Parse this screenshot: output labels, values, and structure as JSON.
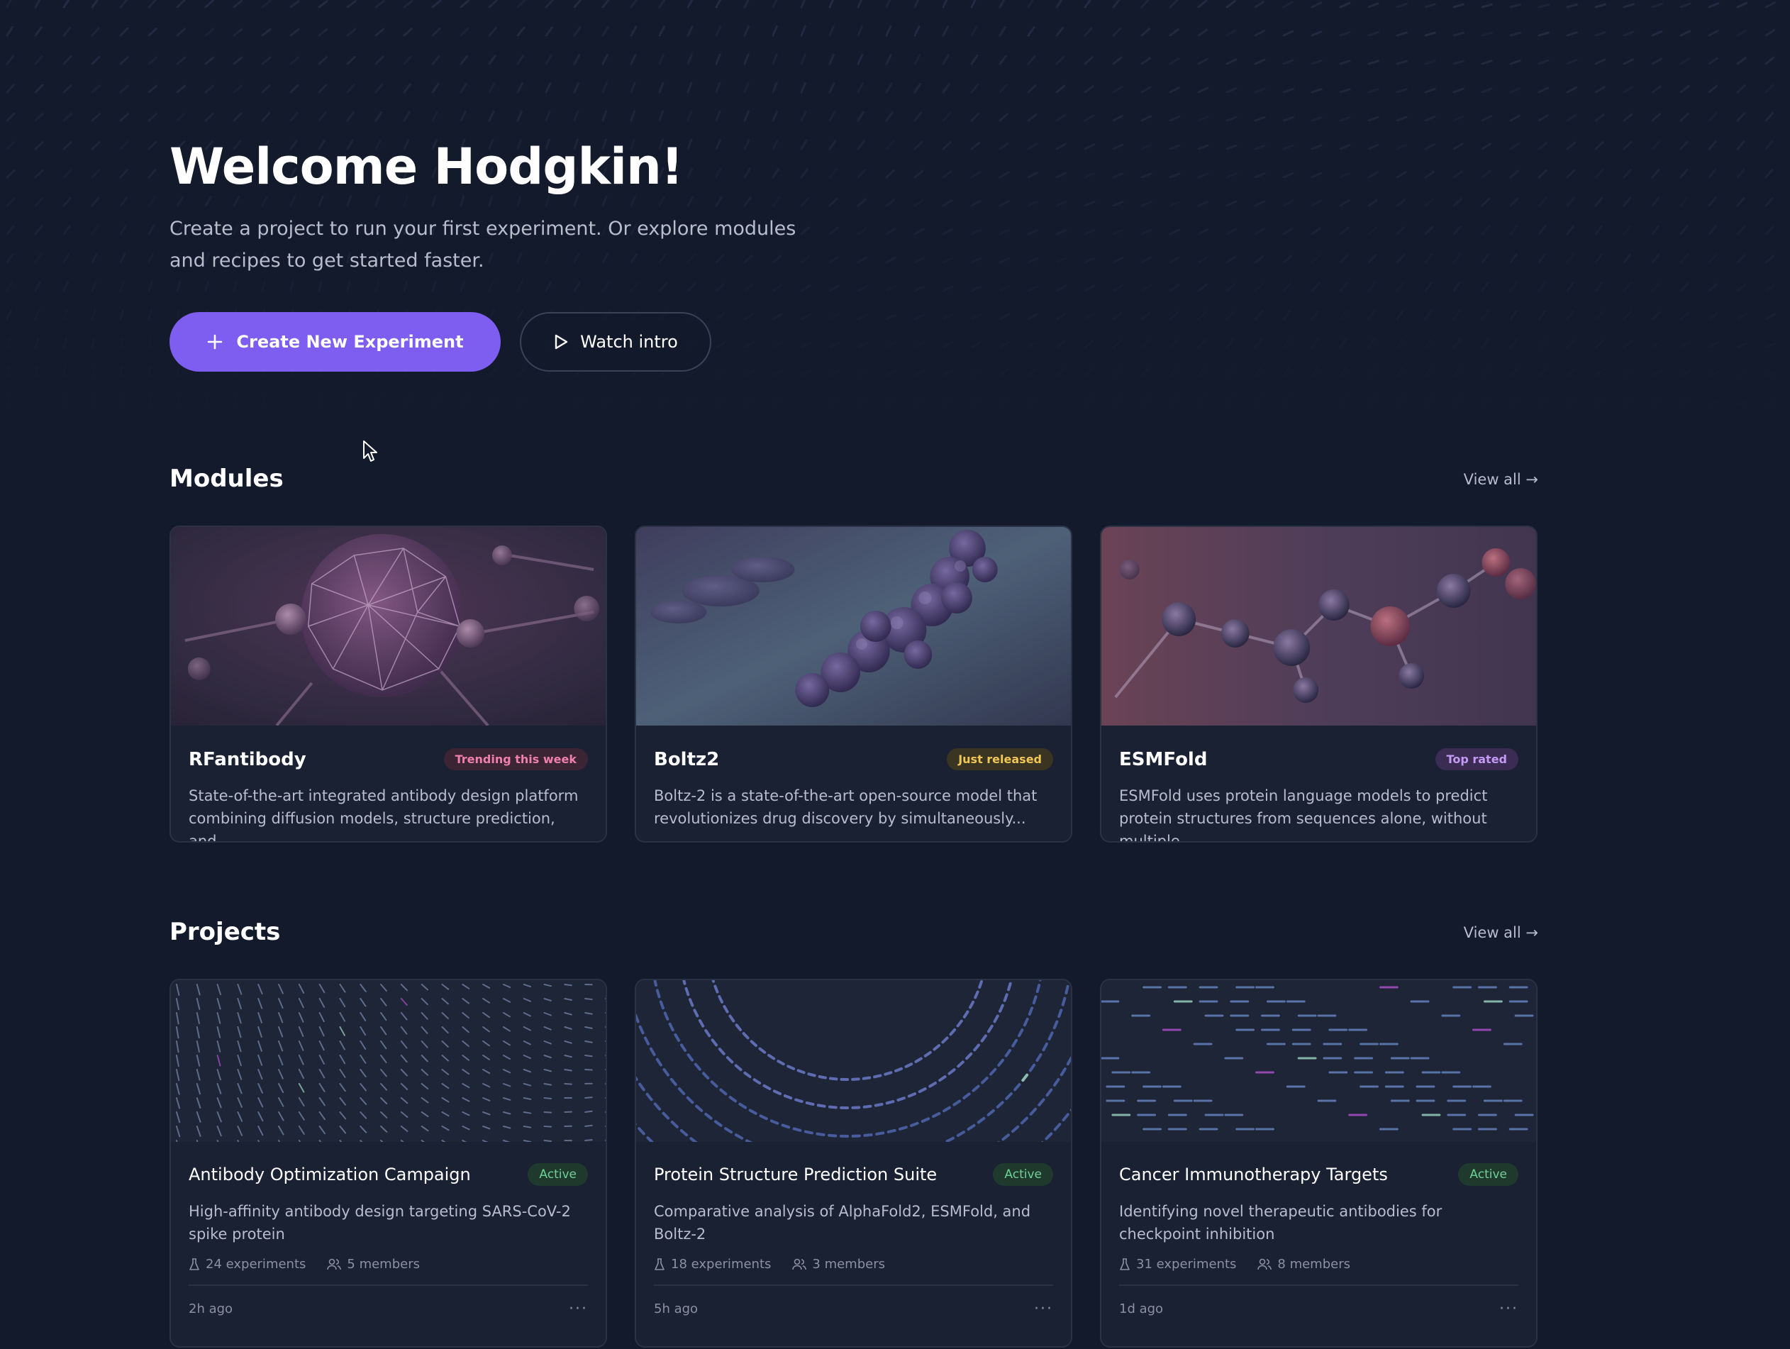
{
  "hero": {
    "title": "Welcome Hodgkin!",
    "subtitle": "Create a project to run your first experiment. Or explore modules and recipes to get started faster.",
    "primary_button": "Create New Experiment",
    "secondary_button": "Watch intro"
  },
  "modules": {
    "title": "Modules",
    "view_all": "View all →",
    "items": [
      {
        "name": "RFantibody",
        "badge": "Trending this week",
        "description": "State-of-the-art integrated antibody design platform combining diffusion models, structure prediction, and..."
      },
      {
        "name": "Boltz2",
        "badge": "Just released",
        "description": "Boltz-2 is a state-of-the-art open-source model that revolutionizes drug discovery by simultaneously..."
      },
      {
        "name": "ESMFold",
        "badge": "Top rated",
        "description": "ESMFold uses protein language models to predict protein structures from sequences alone, without multiple..."
      }
    ]
  },
  "projects": {
    "title": "Projects",
    "view_all": "View all →",
    "items": [
      {
        "name": "Antibody Optimization Campaign",
        "status": "Active",
        "description": "High-affinity antibody design targeting SARS-CoV-2 spike protein",
        "experiments": "24 experiments",
        "members": "5 members",
        "updated": "2h ago"
      },
      {
        "name": "Protein Structure Prediction Suite",
        "status": "Active",
        "description": "Comparative analysis of AlphaFold2, ESMFold, and Boltz-2",
        "experiments": "18 experiments",
        "members": "3 members",
        "updated": "5h ago"
      },
      {
        "name": "Cancer Immunotherapy Targets",
        "status": "Active",
        "description": "Identifying novel therapeutic antibodies for checkpoint inhibition",
        "experiments": "31 experiments",
        "members": "8 members",
        "updated": "1d ago"
      }
    ]
  },
  "colors": {
    "background": "#131a2b",
    "card": "#1a2132",
    "accent": "#7d5ef0",
    "active_badge": "#6fd196"
  }
}
